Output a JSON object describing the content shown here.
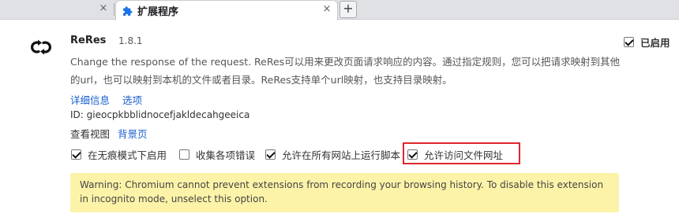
{
  "tabs": [
    {
      "title": "",
      "active": false
    },
    {
      "title": "扩展程序",
      "active": true,
      "icon": "puzzle-piece-icon"
    }
  ],
  "tab_close_glyph": "×",
  "new_tab_glyph": "+",
  "extension": {
    "name": "ReRes",
    "version": "1.8.1",
    "icon": "rotate-arrows-icon",
    "description": "Change the response of the request. ReRes可以用来更改页面请求响应的内容。通过指定规则，您可以把请求映射到其他的url，也可以映射到本机的文件或者目录。ReRes支持单个url映射，也支持目录映射。",
    "details_link": "详细信息",
    "options_link": "选项",
    "id_text": "ID: gieocpkbblidnocefjakldecahgeeica",
    "inspect_views_label": "查看视图",
    "background_page_link": "背景页",
    "enabled_label": "已启用",
    "enabled": true,
    "options": [
      {
        "label": "在无痕模式下启用",
        "checked": true
      },
      {
        "label": "收集各项错误",
        "checked": false
      },
      {
        "label": "允许在所有网站上运行脚本",
        "checked": true
      },
      {
        "label": "允许访问文件网址",
        "checked": true
      }
    ],
    "warning": "Warning: Chromium cannot prevent extensions from recording your browsing history. To disable this extension in incognito mode, unselect this option."
  },
  "colors": {
    "link": "#1a5fd1",
    "warning_bg": "#fdf3a8",
    "highlight_border": "#e0272d",
    "tab_strip": "#dfe1e5",
    "puzzle_icon": "#1a73e8"
  }
}
